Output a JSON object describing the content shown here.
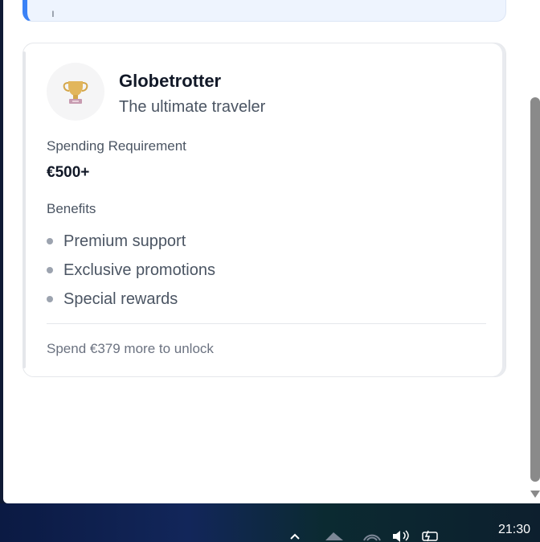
{
  "card": {
    "icon": "trophy-icon",
    "title": "Globetrotter",
    "subtitle": "The ultimate traveler",
    "spending_label": "Spending Requirement",
    "spending_value": "€500+",
    "benefits_label": "Benefits",
    "benefits": [
      "Premium support",
      "Exclusive promotions",
      "Special rewards"
    ],
    "unlock_text": "Spend €379 more to unlock"
  },
  "taskbar": {
    "time": "21:30",
    "icons": [
      "chevron-up-icon",
      "network-icon",
      "wifi-icon",
      "volume-icon",
      "battery-icon"
    ]
  },
  "colors": {
    "accent": "#3b82f6",
    "badge_bg": "#f5f5f6",
    "trophy": "#d4a64a"
  }
}
